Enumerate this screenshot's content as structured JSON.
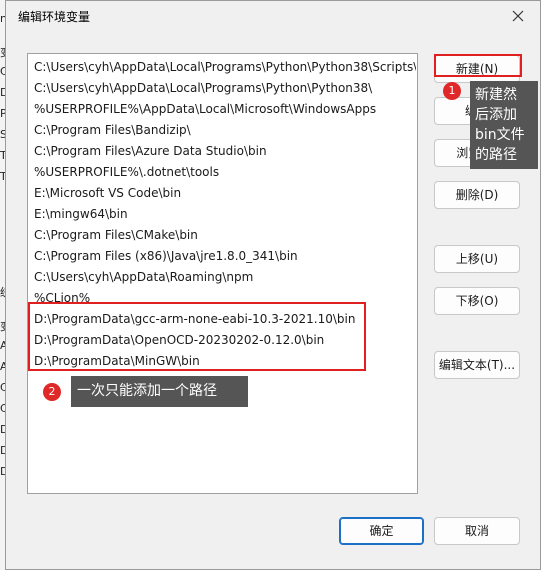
{
  "background_fragments": [
    "n",
    "变",
    "CL",
    "Dr",
    "Pa",
    "SF",
    "TE",
    "TN",
    "统",
    "变",
    "AL",
    "AR",
    "CL",
    "Co",
    "DA",
    "DA",
    "DR"
  ],
  "dialog": {
    "title": "编辑环境变量"
  },
  "path_entries": [
    "C:\\Users\\cyh\\AppData\\Local\\Programs\\Python\\Python38\\Scripts\\",
    "C:\\Users\\cyh\\AppData\\Local\\Programs\\Python\\Python38\\",
    "%USERPROFILE%\\AppData\\Local\\Microsoft\\WindowsApps",
    "C:\\Program Files\\Bandizip\\",
    "C:\\Program Files\\Azure Data Studio\\bin",
    "%USERPROFILE%\\.dotnet\\tools",
    "E:\\Microsoft VS Code\\bin",
    "E:\\mingw64\\bin",
    "C:\\Program Files\\CMake\\bin",
    "C:\\Program Files (x86)\\Java\\jre1.8.0_341\\bin",
    "C:\\Users\\cyh\\AppData\\Roaming\\npm",
    "%CLion%",
    "D:\\ProgramData\\gcc-arm-none-eabi-10.3-2021.10\\bin",
    "D:\\ProgramData\\OpenOCD-20230202-0.12.0\\bin",
    "D:\\ProgramData\\MinGW\\bin"
  ],
  "buttons": {
    "new": "新建(N)",
    "edit": "编辑",
    "browse": "浏览(B)",
    "delete": "删除(D)",
    "move_up": "上移(U)",
    "move_down": "下移(O)",
    "edit_text": "编辑文本(T)...",
    "ok": "确定",
    "cancel": "取消"
  },
  "annotations": {
    "callout1_badge": "1",
    "callout1_text": [
      "新建然",
      "后添加",
      "bin文件",
      "的路径"
    ],
    "callout2_badge": "2",
    "callout2_text": "一次只能添加一个路径"
  },
  "colors": {
    "highlight_red": "#e02020",
    "callout_bg": "#555555",
    "primary_border": "#1a6fc7"
  }
}
